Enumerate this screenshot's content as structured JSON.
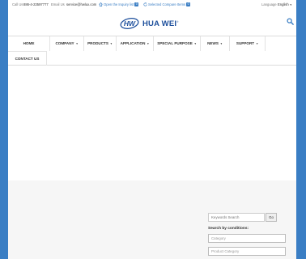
{
  "topbar": {
    "call_label": "Call Us",
    "phone": "886-4-23597777",
    "email_label": "Email Us",
    "email": "service@hwlux.com",
    "inquiry_label": "Open the Inquiry list",
    "inquiry_count": "0",
    "compare_label": "Selected Compare Items",
    "compare_count": "0",
    "language_label": "Language",
    "language_value": "English"
  },
  "logo": {
    "mark": "HW",
    "text": "HUA WEI"
  },
  "nav": {
    "items": [
      {
        "label": "HOME",
        "caret": ""
      },
      {
        "label": "COMPANY",
        "caret": "▼"
      },
      {
        "label": "PRODUCTS",
        "caret": "▼"
      },
      {
        "label": "APPLICATION",
        "caret": "▼"
      },
      {
        "label": "SPECIAL PURPOSE",
        "caret": "▼"
      },
      {
        "label": "NEWS",
        "caret": "▼"
      },
      {
        "label": "SUPPORT",
        "caret": "▼"
      },
      {
        "label": "CONTACT US",
        "caret": ""
      }
    ]
  },
  "sidebar": {
    "keyword_placeholder": "Keywords Search",
    "go_label": "Go",
    "search_by_label": "Search by conditions:",
    "category_placeholder": "Category",
    "product_category_placeholder": "Product Category"
  },
  "colors": {
    "background": "#3a7ec4",
    "brand": "#1d4f9c",
    "accent": "#3a7ec4"
  }
}
